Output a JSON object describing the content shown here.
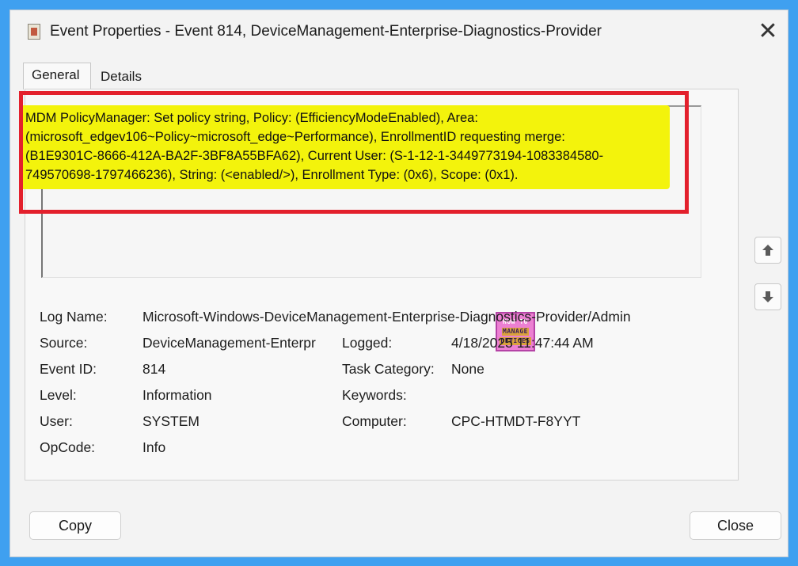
{
  "window": {
    "title": "Event Properties - Event 814, DeviceManagement-Enterprise-Diagnostics-Provider",
    "close_glyph": "✕"
  },
  "tabs": [
    {
      "label": "General",
      "active": true
    },
    {
      "label": "Details",
      "active": false
    }
  ],
  "description": {
    "lines": [
      "MDM PolicyManager: Set policy string, Policy: (EfficiencyModeEnabled), Area:",
      "(microsoft_edgev106~Policy~microsoft_edge~Performance), EnrollmentID requesting merge:",
      "(B1E9301C-8666-412A-BA2F-3BF8A55BFA62), Current User: (S-1-12-1-3449773194-1083384580-",
      "749570698-1797466236), String: (<enabled/>), Enrollment Type: (0x6), Scope: (0x1)."
    ],
    "highlight_color": "#f3f30c",
    "frame_color": "#e3202c"
  },
  "logo": {
    "lines": [
      "HOW TO",
      "MANAGE",
      "DEVICES"
    ]
  },
  "nav": {
    "up_icon": "arrow-up-icon",
    "down_icon": "arrow-down-icon"
  },
  "properties": {
    "log_name": {
      "label": "Log Name:",
      "value": "Microsoft-Windows-DeviceManagement-Enterprise-Diagnostics-Provider/Admin"
    },
    "source": {
      "label": "Source:",
      "value": "DeviceManagement-Enterpr"
    },
    "logged": {
      "label": "Logged:",
      "value": "4/18/2025 11:47:44 AM"
    },
    "event_id": {
      "label": "Event ID:",
      "value": "814"
    },
    "task_category": {
      "label": "Task Category:",
      "value": "None"
    },
    "level": {
      "label": "Level:",
      "value": "Information"
    },
    "keywords": {
      "label": "Keywords:",
      "value": ""
    },
    "user": {
      "label": "User:",
      "value": "SYSTEM"
    },
    "computer": {
      "label": "Computer:",
      "value": "CPC-HTMDT-F8YYT"
    },
    "opcode": {
      "label": "OpCode:",
      "value": "Info"
    }
  },
  "buttons": {
    "copy": "Copy",
    "close": "Close"
  }
}
